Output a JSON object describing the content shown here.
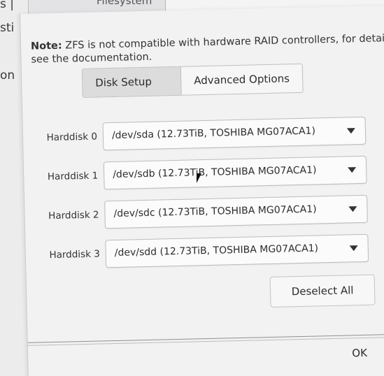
{
  "background": {
    "filesystem_label": "Filesystem",
    "left_fragments": [
      "s |",
      "sti",
      "on"
    ]
  },
  "dialog": {
    "note_bold": "Note:",
    "note_text": " ZFS is not compatible with hardware RAID controllers, for details see the documentation.",
    "tabs": [
      {
        "label": "Disk Setup",
        "active": true
      },
      {
        "label": "Advanced Options",
        "active": false
      }
    ],
    "harddisks": [
      {
        "label": "Harddisk 0",
        "value": "/dev/sda (12.73TiB, TOSHIBA MG07ACA1)"
      },
      {
        "label": "Harddisk 1",
        "value": "/dev/sdb (12.73TiB, TOSHIBA MG07ACA1)"
      },
      {
        "label": "Harddisk 2",
        "value": "/dev/sdc (12.73TiB, TOSHIBA MG07ACA1)"
      },
      {
        "label": "Harddisk 3",
        "value": "/dev/sdd (12.73TiB, TOSHIBA MG07ACA1)"
      }
    ],
    "deselect_label": "Deselect All",
    "ok_label": "OK"
  }
}
